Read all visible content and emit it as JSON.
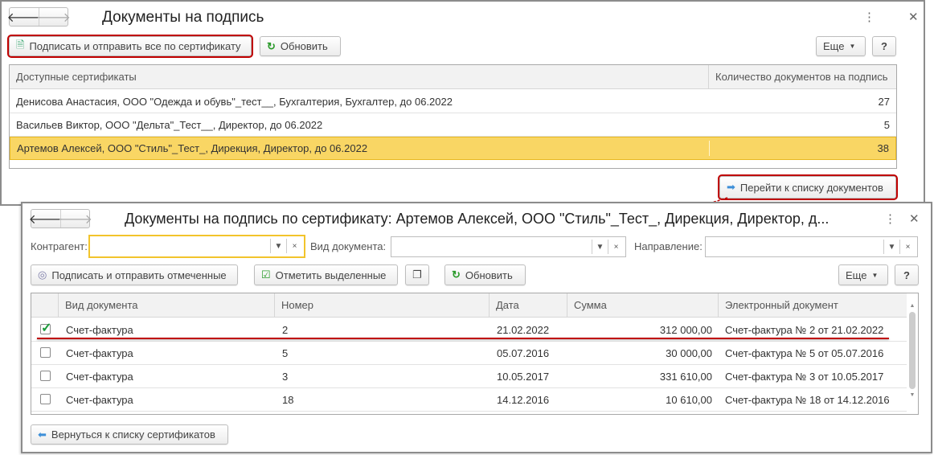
{
  "window1": {
    "title": "Документы на подпись",
    "sign_all_button": "Подписать и отправить все по сертификату",
    "refresh_button": "Обновить",
    "more_button": "Еще",
    "help_button": "?",
    "table": {
      "columns": [
        "Доступные сертификаты",
        "Количество документов на подпись"
      ],
      "rows": [
        {
          "cert": "Денисова Анастасия, ООО \"Одежда и обувь\"_тест__, Бухгалтерия, Бухгалтер, до 06.2022",
          "count": "27"
        },
        {
          "cert": "Васильев Виктор, ООО \"Дельта\"_Тест__, Директор, до 06.2022",
          "count": "5"
        },
        {
          "cert": "Артемов Алексей, ООО \"Стиль\"_Тест_, Дирекция, Директор, до 06.2022",
          "count": "38",
          "selected": true
        }
      ]
    },
    "goto_button": "Перейти к списку документов"
  },
  "window2": {
    "title": "Документы на подпись по сертификату: Артемов Алексей, ООО \"Стиль\"_Тест_, Дирекция, Директор, д...",
    "filters": {
      "counterparty_label": "Контрагент:",
      "doc_type_label": "Вид документа:",
      "direction_label": "Направление:"
    },
    "sign_marked_button": "Подписать и отправить отмеченные",
    "mark_selected_button": "Отметить выделенные",
    "refresh_button": "Обновить",
    "more_button": "Еще",
    "help_button": "?",
    "table": {
      "columns": [
        "Вид документа",
        "Номер",
        "Дата",
        "Сумма",
        "Электронный документ"
      ],
      "rows": [
        {
          "checked": true,
          "type": "Счет-фактура",
          "number": "2",
          "date": "21.02.2022",
          "sum": "312 000,00",
          "edoc": "Счет-фактура № 2  от  21.02.2022"
        },
        {
          "checked": false,
          "type": "Счет-фактура",
          "number": "5",
          "date": "05.07.2016",
          "sum": "30 000,00",
          "edoc": "Счет-фактура № 5 от 05.07.2016"
        },
        {
          "checked": false,
          "type": "Счет-фактура",
          "number": "3",
          "date": "10.05.2017",
          "sum": "331 610,00",
          "edoc": "Счет-фактура № 3 от 10.05.2017"
        },
        {
          "checked": false,
          "type": "Счет-фактура",
          "number": "18",
          "date": "14.12.2016",
          "sum": "10 610,00",
          "edoc": "Счет-фактура № 18 от 14.12.2016"
        }
      ]
    },
    "back_button": "Вернуться к списку сертификатов"
  },
  "colors": {
    "highlight": "#f9d664",
    "annotation_red": "#c00000",
    "focus_yellow": "#f2c42c"
  }
}
